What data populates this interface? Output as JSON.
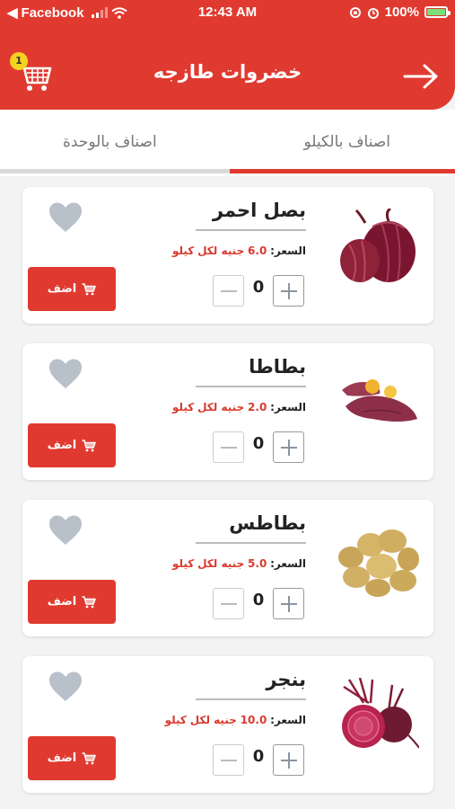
{
  "status_bar": {
    "back_app": "Facebook",
    "time": "12:43 AM",
    "battery": "100%"
  },
  "header": {
    "title": "خضروات طازجه",
    "cart_count": "1"
  },
  "tabs": [
    {
      "label": "اصناف بالكيلو",
      "active": true
    },
    {
      "label": "اصناف بالوحدة",
      "active": false
    }
  ],
  "price_label": "السعر:",
  "currency_word": "جنيه لكل",
  "unit_word": "كيلو",
  "add_label": "اضف",
  "products": [
    {
      "name": "بصل احمر",
      "price": "6.0",
      "qty": "0",
      "image": "red-onion"
    },
    {
      "name": "بطاطا",
      "price": "2.0",
      "qty": "0",
      "image": "sweet-potato"
    },
    {
      "name": "بطاطس",
      "price": "5.0",
      "qty": "0",
      "image": "potatoes"
    },
    {
      "name": "بنجر",
      "price": "10.0",
      "qty": "0",
      "image": "beetroot"
    }
  ],
  "colors": {
    "primary": "#e03a30",
    "heart": "#b8c0ca"
  }
}
